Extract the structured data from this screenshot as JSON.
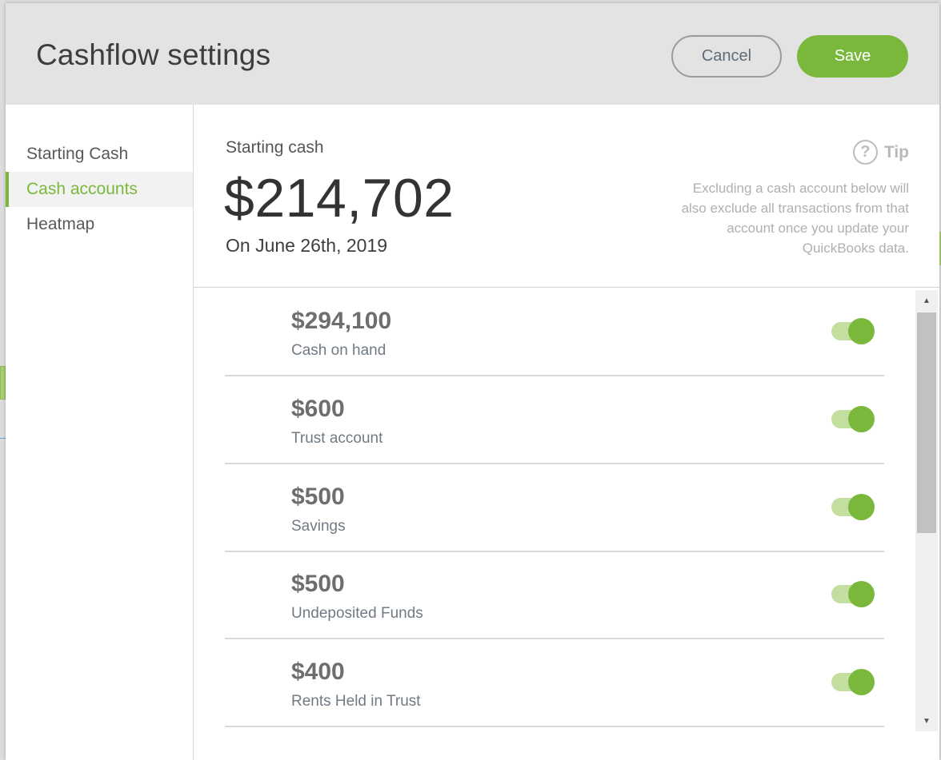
{
  "dialog": {
    "title": "Cashflow settings",
    "cancel_label": "Cancel",
    "save_label": "Save"
  },
  "sidebar": {
    "items": [
      {
        "label": "Starting Cash",
        "active": false
      },
      {
        "label": "Cash accounts",
        "active": true
      },
      {
        "label": "Heatmap",
        "active": false
      }
    ]
  },
  "summary": {
    "label": "Starting cash",
    "amount": "$214,702",
    "date": "On June 26th, 2019",
    "tip_label": "Tip",
    "tip_text": "Excluding a cash account below will also exclude all transactions from that account once you update your QuickBooks data."
  },
  "accounts": [
    {
      "amount": "$294,100",
      "name": "Cash on hand",
      "included": true
    },
    {
      "amount": "$600",
      "name": "Trust account",
      "included": true
    },
    {
      "amount": "$500",
      "name": "Savings",
      "included": true
    },
    {
      "amount": "$500",
      "name": "Undeposited Funds",
      "included": true
    },
    {
      "amount": "$400",
      "name": "Rents Held in Trust",
      "included": true
    }
  ],
  "colors": {
    "accent": "#7ab83c",
    "toggle_track": "#c3df9f",
    "header_bg": "#e3e3e3"
  },
  "icons": {
    "tip": "question-circle-icon",
    "scroll_up": "triangle-up-icon",
    "scroll_down": "triangle-down-icon"
  }
}
